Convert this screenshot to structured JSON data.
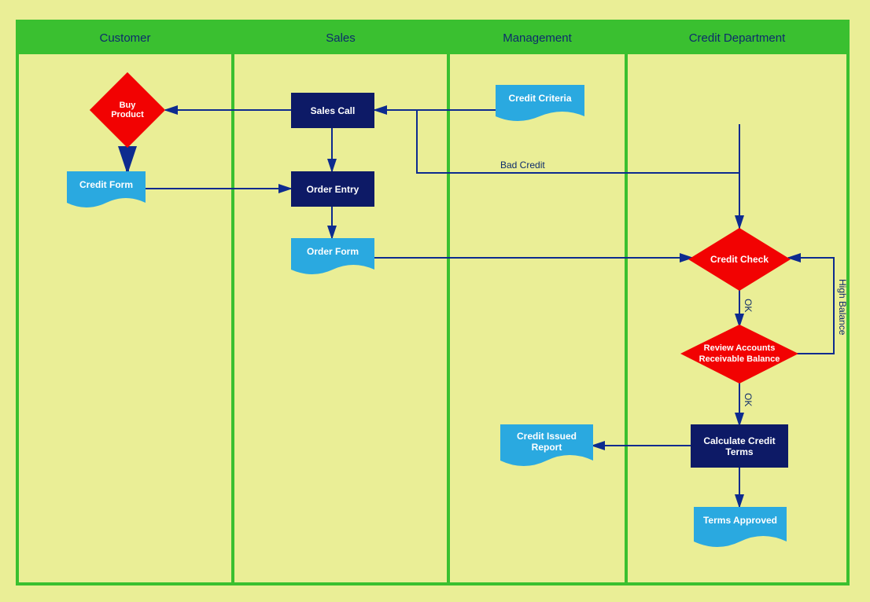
{
  "lanes": {
    "customer": "Customer",
    "sales": "Sales",
    "management": "Management",
    "credit": "Credit Department"
  },
  "nodes": {
    "buy_product": "Buy Product",
    "credit_form": "Credit Form",
    "sales_call": "Sales Call",
    "order_entry": "Order Entry",
    "order_form": "Order Form",
    "credit_criteria": "Credit Criteria",
    "credit_check": "Credit Check",
    "review_balance": "Review Accounts Receivable Balance",
    "calculate_terms": "Calculate Credit Terms",
    "credit_issued_report": "Credit Issued Report",
    "terms_approved": "Terms Approved"
  },
  "edges": {
    "bad_credit": "Bad Credit",
    "ok1": "OK",
    "ok2": "OK",
    "high_balance": "High Balance"
  }
}
